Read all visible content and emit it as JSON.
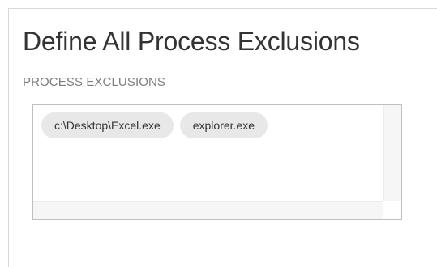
{
  "page": {
    "title": "Define All Process Exclusions",
    "section_label": "PROCESS EXCLUSIONS"
  },
  "exclusions": {
    "items": [
      {
        "label": "c:\\Desktop\\Excel.exe"
      },
      {
        "label": "explorer.exe"
      }
    ]
  },
  "colors": {
    "title_text": "#333333",
    "label_text": "#7d7d7d",
    "chip_background": "#e8e8e8",
    "box_border": "#bfbfbf"
  }
}
